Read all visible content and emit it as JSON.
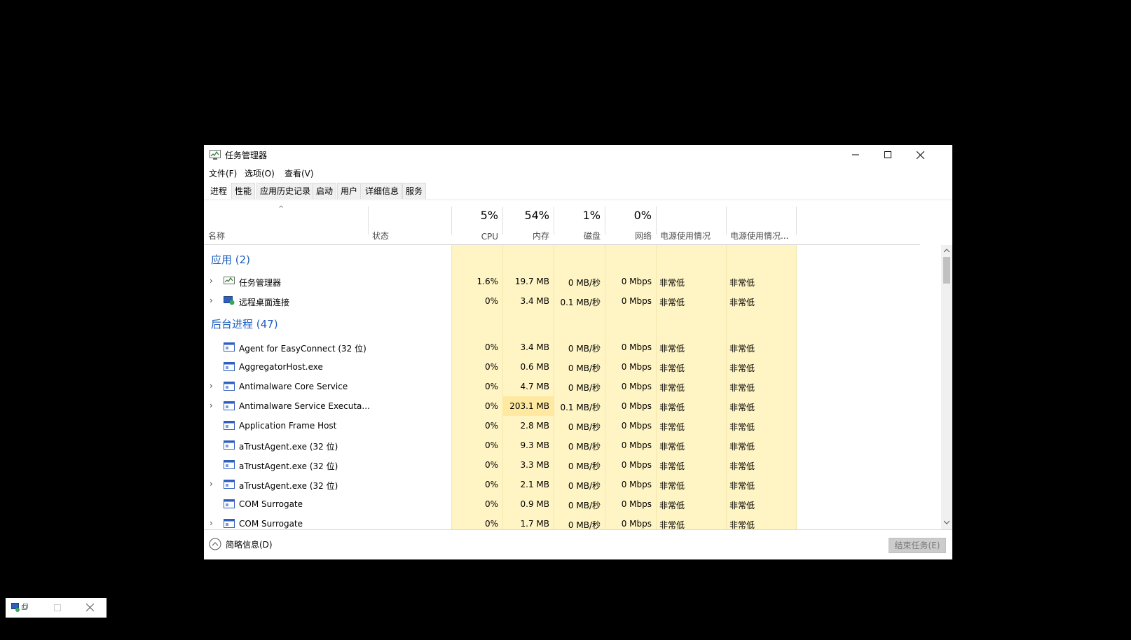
{
  "window": {
    "title": "任务管理器",
    "menu": [
      "文件(F)",
      "选项(O)",
      "查看(V)"
    ],
    "tabs": [
      "进程",
      "性能",
      "应用历史记录",
      "启动",
      "用户",
      "详细信息",
      "服务"
    ],
    "active_tab": "进程"
  },
  "columns": {
    "name": "名称",
    "status": "状态",
    "cpu_pct": "5%",
    "cpu": "CPU",
    "mem_pct": "54%",
    "mem": "内存",
    "disk_pct": "1%",
    "disk": "磁盘",
    "net_pct": "0%",
    "net": "网络",
    "power": "电源使用情况",
    "power_trend": "电源使用情况..."
  },
  "groups": {
    "apps": "应用 (2)",
    "background": "后台进程 (47)"
  },
  "apps": [
    {
      "name": "任务管理器",
      "cpu": "1.6%",
      "mem": "19.7 MB",
      "disk": "0 MB/秒",
      "net": "0 Mbps",
      "power": "非常低",
      "power_trend": "非常低"
    },
    {
      "name": "远程桌面连接",
      "cpu": "0%",
      "mem": "3.4 MB",
      "disk": "0.1 MB/秒",
      "net": "0 Mbps",
      "power": "非常低",
      "power_trend": "非常低"
    }
  ],
  "background": [
    {
      "name": "Agent for EasyConnect (32 位)",
      "cpu": "0%",
      "mem": "3.4 MB",
      "disk": "0 MB/秒",
      "net": "0 Mbps",
      "power": "非常低",
      "power_trend": "非常低"
    },
    {
      "name": "AggregatorHost.exe",
      "cpu": "0%",
      "mem": "0.6 MB",
      "disk": "0 MB/秒",
      "net": "0 Mbps",
      "power": "非常低",
      "power_trend": "非常低"
    },
    {
      "name": "Antimalware Core Service",
      "cpu": "0%",
      "mem": "4.7 MB",
      "disk": "0 MB/秒",
      "net": "0 Mbps",
      "power": "非常低",
      "power_trend": "非常低"
    },
    {
      "name": "Antimalware Service Executa...",
      "cpu": "0%",
      "mem": "203.1 MB",
      "disk": "0.1 MB/秒",
      "net": "0 Mbps",
      "power": "非常低",
      "power_trend": "非常低"
    },
    {
      "name": "Application Frame Host",
      "cpu": "0%",
      "mem": "2.8 MB",
      "disk": "0 MB/秒",
      "net": "0 Mbps",
      "power": "非常低",
      "power_trend": "非常低"
    },
    {
      "name": "aTrustAgent.exe (32 位)",
      "cpu": "0%",
      "mem": "9.3 MB",
      "disk": "0 MB/秒",
      "net": "0 Mbps",
      "power": "非常低",
      "power_trend": "非常低"
    },
    {
      "name": "aTrustAgent.exe (32 位)",
      "cpu": "0%",
      "mem": "3.3 MB",
      "disk": "0 MB/秒",
      "net": "0 Mbps",
      "power": "非常低",
      "power_trend": "非常低"
    },
    {
      "name": "aTrustAgent.exe (32 位)",
      "cpu": "0%",
      "mem": "2.1 MB",
      "disk": "0 MB/秒",
      "net": "0 Mbps",
      "power": "非常低",
      "power_trend": "非常低"
    },
    {
      "name": "COM Surrogate",
      "cpu": "0%",
      "mem": "0.9 MB",
      "disk": "0 MB/秒",
      "net": "0 Mbps",
      "power": "非常低",
      "power_trend": "非常低"
    },
    {
      "name": "COM Surrogate",
      "cpu": "0%",
      "mem": "1.7 MB",
      "disk": "0 MB/秒",
      "net": "0 Mbps",
      "power": "非常低",
      "power_trend": "非常低"
    }
  ],
  "footer": {
    "less_details": "简略信息(D)",
    "end_task": "结束任务(E)"
  },
  "colors": {
    "heat_light": "#fff4c4",
    "heat_mid": "#ffe9a0",
    "group_text": "#1e5ebd"
  }
}
